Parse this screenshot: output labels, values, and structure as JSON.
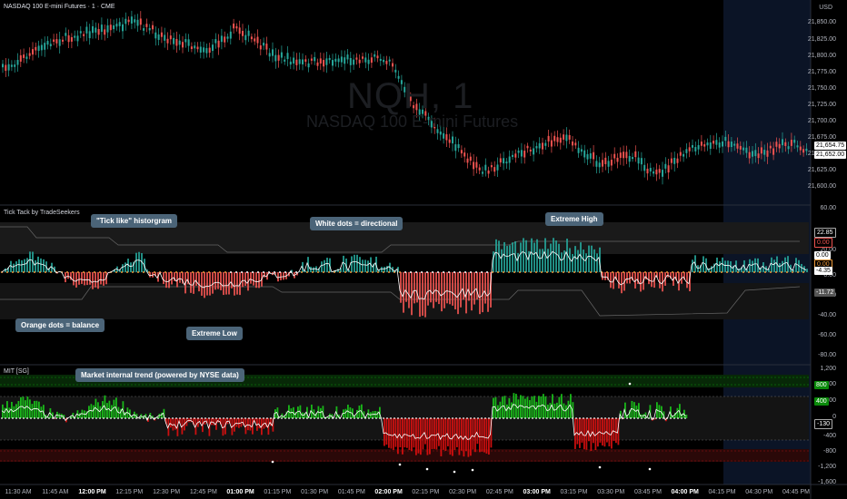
{
  "header": {
    "symbol_title": "NASDAQ 100 E-mini Futures · 1 · CME",
    "currency": "USD",
    "watermark_symbol": "NQH, 1",
    "watermark_name": "NASDAQ 100 E-mini Futures"
  },
  "price_axis": {
    "labels": [
      "21,850.00",
      "21,825.00",
      "21,800.00",
      "21,775.00",
      "21,750.00",
      "21,725.00",
      "21,700.00",
      "21,675.00",
      "21,650.00",
      "21,625.00",
      "21,600.00"
    ],
    "tag_high": "21,654.75",
    "tag_last": "21,652.00"
  },
  "tick_pane": {
    "title": "Tick Tack by TradeSeekers",
    "axis_labels": [
      "60.00",
      "40.00",
      "20.00",
      "0.00",
      "-20.00",
      "-40.00",
      "-60.00",
      "-80.00"
    ],
    "tags": [
      "22.85",
      "0.00",
      "0.00",
      "0.00",
      "-4.35",
      "-11.72"
    ]
  },
  "mit_pane": {
    "title": "MIT [SG]",
    "axis_labels": [
      "1,200",
      "800",
      "400",
      "0",
      "-400",
      "-800",
      "-1,200",
      "-1,600"
    ],
    "tags": [
      "800",
      "400",
      "-130"
    ]
  },
  "time_axis": {
    "labels": [
      "11:30 AM",
      "11:45 AM",
      "12:00 PM",
      "12:15 PM",
      "12:30 PM",
      "12:45 PM",
      "01:00 PM",
      "01:15 PM",
      "01:30 PM",
      "01:45 PM",
      "02:00 PM",
      "02:15 PM",
      "02:30 PM",
      "02:45 PM",
      "03:00 PM",
      "03:15 PM",
      "03:30 PM",
      "03:45 PM",
      "04:00 PM",
      "04:15 PM",
      "04:30 PM",
      "04:45 PM"
    ],
    "bold": [
      "12:00 PM",
      "01:00 PM",
      "02:00 PM",
      "03:00 PM",
      "04:00 PM"
    ]
  },
  "callouts": {
    "tick_like": "\"Tick like\" historgram",
    "white_dots": "White dots = directional",
    "extreme_high": "Extreme High",
    "orange_dots": "Orange dots = balance",
    "extreme_low": "Extreme Low",
    "market_internal": "Market internal trend (powered by NYSE data)"
  },
  "colors": {
    "up": "#26a69a",
    "down": "#ef5350",
    "bright_green": "#19c919",
    "bright_red": "#e01010",
    "callout_bg": "#4b6478",
    "session_shade": "#0b1426"
  }
}
